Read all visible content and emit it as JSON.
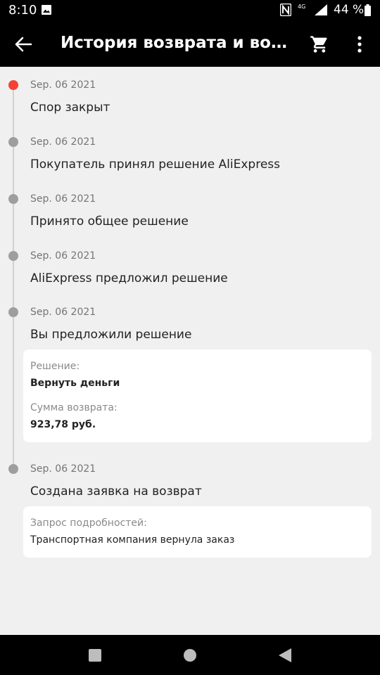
{
  "status_bar": {
    "time": "8:10",
    "network": "4G",
    "battery_percent": "44 %"
  },
  "app_bar": {
    "title": "История возврата и возвр..."
  },
  "timeline": {
    "events": [
      {
        "date": "Sep. 06 2021",
        "title": "Спор закрыт",
        "active": true
      },
      {
        "date": "Sep. 06 2021",
        "title": "Покупатель принял решение AliExpress"
      },
      {
        "date": "Sep. 06 2021",
        "title": "Принято общее решение"
      },
      {
        "date": "Sep. 06 2021",
        "title": "AliExpress предложил решение"
      },
      {
        "date": "Sep. 06 2021",
        "title": "Вы предложили решение",
        "details": {
          "decision_label": "Решение:",
          "decision_value": "Вернуть деньги",
          "amount_label": "Сумма возврата:",
          "amount_value": "923,78 руб."
        }
      },
      {
        "date": "Sep. 06 2021",
        "title": "Создана заявка на возврат",
        "details": {
          "request_label": "Запрос подробностей:",
          "request_value": "Транспортная компания вернула заказ"
        }
      }
    ]
  },
  "colors": {
    "active_dot": "#f44336",
    "inactive_dot": "#9e9e9e",
    "background": "#f0f0f0"
  }
}
